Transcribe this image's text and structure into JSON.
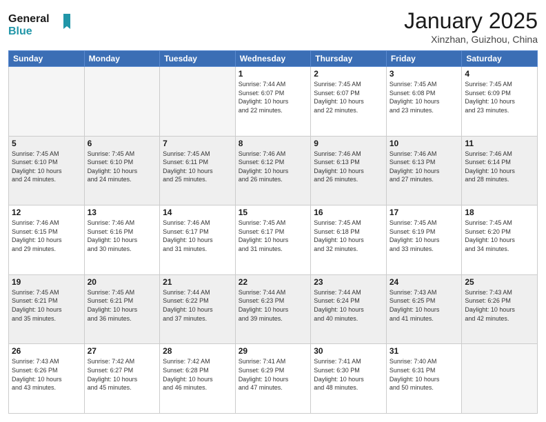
{
  "logo": {
    "line1": "General",
    "line2": "Blue"
  },
  "header": {
    "title": "January 2025",
    "location": "Xinzhan, Guizhou, China"
  },
  "weekdays": [
    "Sunday",
    "Monday",
    "Tuesday",
    "Wednesday",
    "Thursday",
    "Friday",
    "Saturday"
  ],
  "weeks": [
    [
      {
        "day": "",
        "info": ""
      },
      {
        "day": "",
        "info": ""
      },
      {
        "day": "",
        "info": ""
      },
      {
        "day": "1",
        "info": "Sunrise: 7:44 AM\nSunset: 6:07 PM\nDaylight: 10 hours\nand 22 minutes."
      },
      {
        "day": "2",
        "info": "Sunrise: 7:45 AM\nSunset: 6:07 PM\nDaylight: 10 hours\nand 22 minutes."
      },
      {
        "day": "3",
        "info": "Sunrise: 7:45 AM\nSunset: 6:08 PM\nDaylight: 10 hours\nand 23 minutes."
      },
      {
        "day": "4",
        "info": "Sunrise: 7:45 AM\nSunset: 6:09 PM\nDaylight: 10 hours\nand 23 minutes."
      }
    ],
    [
      {
        "day": "5",
        "info": "Sunrise: 7:45 AM\nSunset: 6:10 PM\nDaylight: 10 hours\nand 24 minutes."
      },
      {
        "day": "6",
        "info": "Sunrise: 7:45 AM\nSunset: 6:10 PM\nDaylight: 10 hours\nand 24 minutes."
      },
      {
        "day": "7",
        "info": "Sunrise: 7:45 AM\nSunset: 6:11 PM\nDaylight: 10 hours\nand 25 minutes."
      },
      {
        "day": "8",
        "info": "Sunrise: 7:46 AM\nSunset: 6:12 PM\nDaylight: 10 hours\nand 26 minutes."
      },
      {
        "day": "9",
        "info": "Sunrise: 7:46 AM\nSunset: 6:13 PM\nDaylight: 10 hours\nand 26 minutes."
      },
      {
        "day": "10",
        "info": "Sunrise: 7:46 AM\nSunset: 6:13 PM\nDaylight: 10 hours\nand 27 minutes."
      },
      {
        "day": "11",
        "info": "Sunrise: 7:46 AM\nSunset: 6:14 PM\nDaylight: 10 hours\nand 28 minutes."
      }
    ],
    [
      {
        "day": "12",
        "info": "Sunrise: 7:46 AM\nSunset: 6:15 PM\nDaylight: 10 hours\nand 29 minutes."
      },
      {
        "day": "13",
        "info": "Sunrise: 7:46 AM\nSunset: 6:16 PM\nDaylight: 10 hours\nand 30 minutes."
      },
      {
        "day": "14",
        "info": "Sunrise: 7:46 AM\nSunset: 6:17 PM\nDaylight: 10 hours\nand 31 minutes."
      },
      {
        "day": "15",
        "info": "Sunrise: 7:45 AM\nSunset: 6:17 PM\nDaylight: 10 hours\nand 31 minutes."
      },
      {
        "day": "16",
        "info": "Sunrise: 7:45 AM\nSunset: 6:18 PM\nDaylight: 10 hours\nand 32 minutes."
      },
      {
        "day": "17",
        "info": "Sunrise: 7:45 AM\nSunset: 6:19 PM\nDaylight: 10 hours\nand 33 minutes."
      },
      {
        "day": "18",
        "info": "Sunrise: 7:45 AM\nSunset: 6:20 PM\nDaylight: 10 hours\nand 34 minutes."
      }
    ],
    [
      {
        "day": "19",
        "info": "Sunrise: 7:45 AM\nSunset: 6:21 PM\nDaylight: 10 hours\nand 35 minutes."
      },
      {
        "day": "20",
        "info": "Sunrise: 7:45 AM\nSunset: 6:21 PM\nDaylight: 10 hours\nand 36 minutes."
      },
      {
        "day": "21",
        "info": "Sunrise: 7:44 AM\nSunset: 6:22 PM\nDaylight: 10 hours\nand 37 minutes."
      },
      {
        "day": "22",
        "info": "Sunrise: 7:44 AM\nSunset: 6:23 PM\nDaylight: 10 hours\nand 39 minutes."
      },
      {
        "day": "23",
        "info": "Sunrise: 7:44 AM\nSunset: 6:24 PM\nDaylight: 10 hours\nand 40 minutes."
      },
      {
        "day": "24",
        "info": "Sunrise: 7:43 AM\nSunset: 6:25 PM\nDaylight: 10 hours\nand 41 minutes."
      },
      {
        "day": "25",
        "info": "Sunrise: 7:43 AM\nSunset: 6:26 PM\nDaylight: 10 hours\nand 42 minutes."
      }
    ],
    [
      {
        "day": "26",
        "info": "Sunrise: 7:43 AM\nSunset: 6:26 PM\nDaylight: 10 hours\nand 43 minutes."
      },
      {
        "day": "27",
        "info": "Sunrise: 7:42 AM\nSunset: 6:27 PM\nDaylight: 10 hours\nand 45 minutes."
      },
      {
        "day": "28",
        "info": "Sunrise: 7:42 AM\nSunset: 6:28 PM\nDaylight: 10 hours\nand 46 minutes."
      },
      {
        "day": "29",
        "info": "Sunrise: 7:41 AM\nSunset: 6:29 PM\nDaylight: 10 hours\nand 47 minutes."
      },
      {
        "day": "30",
        "info": "Sunrise: 7:41 AM\nSunset: 6:30 PM\nDaylight: 10 hours\nand 48 minutes."
      },
      {
        "day": "31",
        "info": "Sunrise: 7:40 AM\nSunset: 6:31 PM\nDaylight: 10 hours\nand 50 minutes."
      },
      {
        "day": "",
        "info": ""
      }
    ]
  ]
}
